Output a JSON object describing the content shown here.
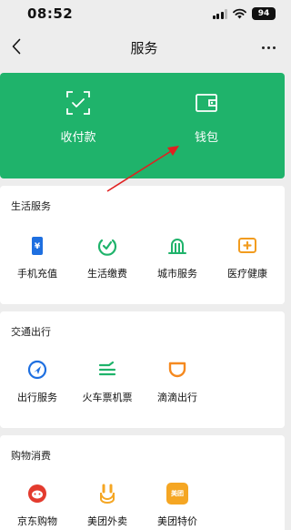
{
  "status_bar": {
    "time": "08:52",
    "battery": "94"
  },
  "nav": {
    "title": "服务"
  },
  "pay_card": {
    "items": [
      {
        "label": "收付款",
        "icon": "scan-pay-icon"
      },
      {
        "label": "钱包",
        "icon": "wallet-icon"
      }
    ]
  },
  "sections": [
    {
      "title": "生活服务",
      "items": [
        {
          "label": "手机充值",
          "icon": "phone-recharge-icon",
          "color": "#1e6fe0"
        },
        {
          "label": "生活缴费",
          "icon": "utility-payment-icon",
          "color": "#1fb36b"
        },
        {
          "label": "城市服务",
          "icon": "city-service-icon",
          "color": "#1fb36b"
        },
        {
          "label": "医疗健康",
          "icon": "medical-health-icon",
          "color": "#f29c1f"
        }
      ]
    },
    {
      "title": "交通出行",
      "items": [
        {
          "label": "出行服务",
          "icon": "travel-service-icon",
          "color": "#1e6fe0"
        },
        {
          "label": "火车票机票",
          "icon": "train-flight-ticket-icon",
          "color": "#1fb36b"
        },
        {
          "label": "滴滴出行",
          "icon": "didi-icon",
          "color": "#f5891f"
        }
      ]
    },
    {
      "title": "购物消费",
      "items": [
        {
          "label": "京东购物",
          "icon": "jd-shopping-icon",
          "color": "#e33b2e"
        },
        {
          "label": "美团外卖",
          "icon": "meituan-delivery-icon",
          "color": "#f5a623"
        },
        {
          "label": "美团特价",
          "icon": "meituan-deals-icon",
          "color": "#f5a623",
          "badge": "美团"
        }
      ]
    }
  ]
}
